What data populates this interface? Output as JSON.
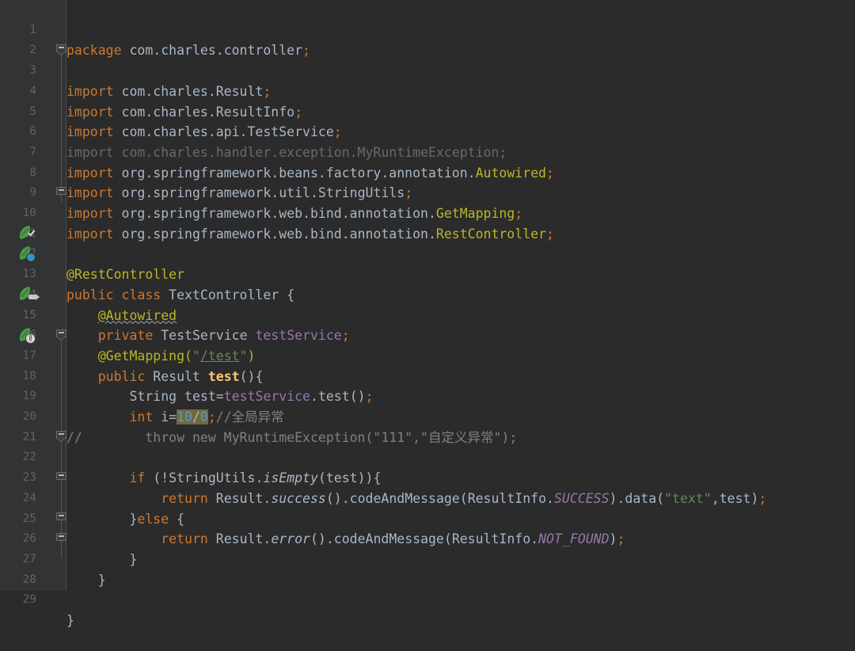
{
  "editor": {
    "theme_name": "darcula",
    "background": "#2b2b2b",
    "gutter_background": "#313335",
    "line_number_color": "#606366",
    "default_text_color": "#a9b7c6",
    "keyword_color": "#cc7832",
    "string_color": "#6a8759",
    "number_color": "#6897bb",
    "annotation_color": "#bbb529",
    "field_color": "#9876aa",
    "method_declaration_color": "#ffc66d",
    "comment_color": "#808080",
    "unused_import_color": "#6a6a6a",
    "warning_highlight_color": "#6e6b3f",
    "first_line": 1,
    "last_line": 29,
    "language": "Java",
    "class_name": "TextController",
    "package": "com.charles.controller"
  },
  "lines": [
    {
      "n": "1",
      "text": "package com.charles.controller;"
    },
    {
      "n": "2",
      "text": ""
    },
    {
      "n": "3",
      "text": "import com.charles.Result;"
    },
    {
      "n": "4",
      "text": "import com.charles.ResultInfo;"
    },
    {
      "n": "5",
      "text": "import com.charles.api.TestService;"
    },
    {
      "n": "6",
      "text": "import com.charles.handler.exception.MyRuntimeException;"
    },
    {
      "n": "7",
      "text": "import org.springframework.beans.factory.annotation.Autowired;"
    },
    {
      "n": "8",
      "text": "import org.springframework.util.StringUtils;"
    },
    {
      "n": "9",
      "text": "import org.springframework.web.bind.annotation.GetMapping;"
    },
    {
      "n": "10",
      "text": "import org.springframework.web.bind.annotation.RestController;"
    },
    {
      "n": "11",
      "text": ""
    },
    {
      "n": "12",
      "text": "@RestController"
    },
    {
      "n": "13",
      "text": "public class TextController {"
    },
    {
      "n": "14",
      "text": "    @Autowired"
    },
    {
      "n": "15",
      "text": "    private TestService testService;"
    },
    {
      "n": "16",
      "text": "    @GetMapping(\"/test\")"
    },
    {
      "n": "17",
      "text": "    public Result test(){"
    },
    {
      "n": "18",
      "text": "        String test=testService.test();"
    },
    {
      "n": "19",
      "text": "        int i=10/0;//全局异常"
    },
    {
      "n": "20",
      "text": "//        throw new MyRuntimeException(\"111\",\"自定义异常\");"
    },
    {
      "n": "21",
      "text": ""
    },
    {
      "n": "22",
      "text": "        if (!StringUtils.isEmpty(test)){"
    },
    {
      "n": "23",
      "text": "            return Result.success().codeAndMessage(ResultInfo.SUCCESS).data(\"text\",test);"
    },
    {
      "n": "24",
      "text": "        }else {"
    },
    {
      "n": "25",
      "text": "            return Result.error().codeAndMessage(ResultInfo.NOT_FOUND);"
    },
    {
      "n": "26",
      "text": "        }"
    },
    {
      "n": "27",
      "text": "    }"
    },
    {
      "n": "28",
      "text": ""
    },
    {
      "n": "29",
      "text": "}"
    }
  ],
  "tokens": {
    "kw_package": "package",
    "kw_import": "import",
    "kw_public": "public",
    "kw_class": "class",
    "kw_private": "private",
    "kw_int": "int",
    "kw_new": "new",
    "kw_return": "return",
    "kw_if": "if",
    "kw_else": "else",
    "kw_throw": "throw",
    "pkg_name": "com.charles.controller",
    "imp_result": "com.charles.Result",
    "imp_resultinfo": "com.charles.ResultInfo",
    "imp_testservice": "com.charles.api.TestService",
    "imp_myruntime": "com.charles.handler.exception.MyRuntimeException",
    "imp_autowired_pkg": "org.springframework.beans.factory.annotation.",
    "imp_autowired_cls": "Autowired",
    "imp_stringutils_pkg": "org.springframework.util.",
    "imp_stringutils_cls": "StringUtils",
    "imp_getmapping_pkg": "org.springframework.web.bind.annotation.",
    "imp_getmapping_cls": "GetMapping",
    "imp_restcontroller_pkg": "org.springframework.web.bind.annotation.",
    "imp_restcontroller_cls": "RestController",
    "anno_restcontroller": "@RestController",
    "anno_autowired": "@Autowired",
    "anno_getmapping": "@GetMapping",
    "class_name": "TextController",
    "type_testservice": "TestService",
    "field_testservice": "testService",
    "mapping_path": "/test",
    "type_result": "Result",
    "method_test": "test",
    "type_string": "String",
    "var_test": "test",
    "num_10": "10",
    "num_0": "0",
    "div": "/",
    "comment_global_exception": "//全局异常",
    "comment_prefix": "//",
    "commented_throw": "        throw new MyRuntimeException(\"111\",\"自定义异常\");",
    "str_111": "\"111\"",
    "str_custom_exception": "\"自定义异常\"",
    "cls_stringutils": "StringUtils",
    "m_isempty": "isEmpty",
    "m_success": "success",
    "m_error": "error",
    "m_codeandmessage": "codeAndMessage",
    "m_data": "data",
    "cls_resultinfo": "ResultInfo",
    "const_success": "SUCCESS",
    "const_not_found": "NOT_FOUND",
    "str_text": "\"text\""
  },
  "gutter_icons": [
    {
      "line": "12",
      "name": "spring-bean-checked-icon",
      "badge": "check"
    },
    {
      "line": "13",
      "name": "spring-bean-class-icon",
      "badge": "blue"
    },
    {
      "line": "15",
      "name": "spring-bean-autowired-icon",
      "badge": "arrow"
    },
    {
      "line": "17",
      "name": "spring-request-mapping-icon",
      "badge": "globe"
    }
  ],
  "fold_markers": [
    {
      "line": "3",
      "state": "expanded"
    },
    {
      "line": "10",
      "state": "collapsed-end"
    },
    {
      "line": "17",
      "state": "expanded"
    },
    {
      "line": "22",
      "state": "expanded"
    },
    {
      "line": "24",
      "state": "collapsed-end"
    },
    {
      "line": "26",
      "state": "collapsed-end"
    },
    {
      "line": "27",
      "state": "collapsed-end"
    }
  ]
}
